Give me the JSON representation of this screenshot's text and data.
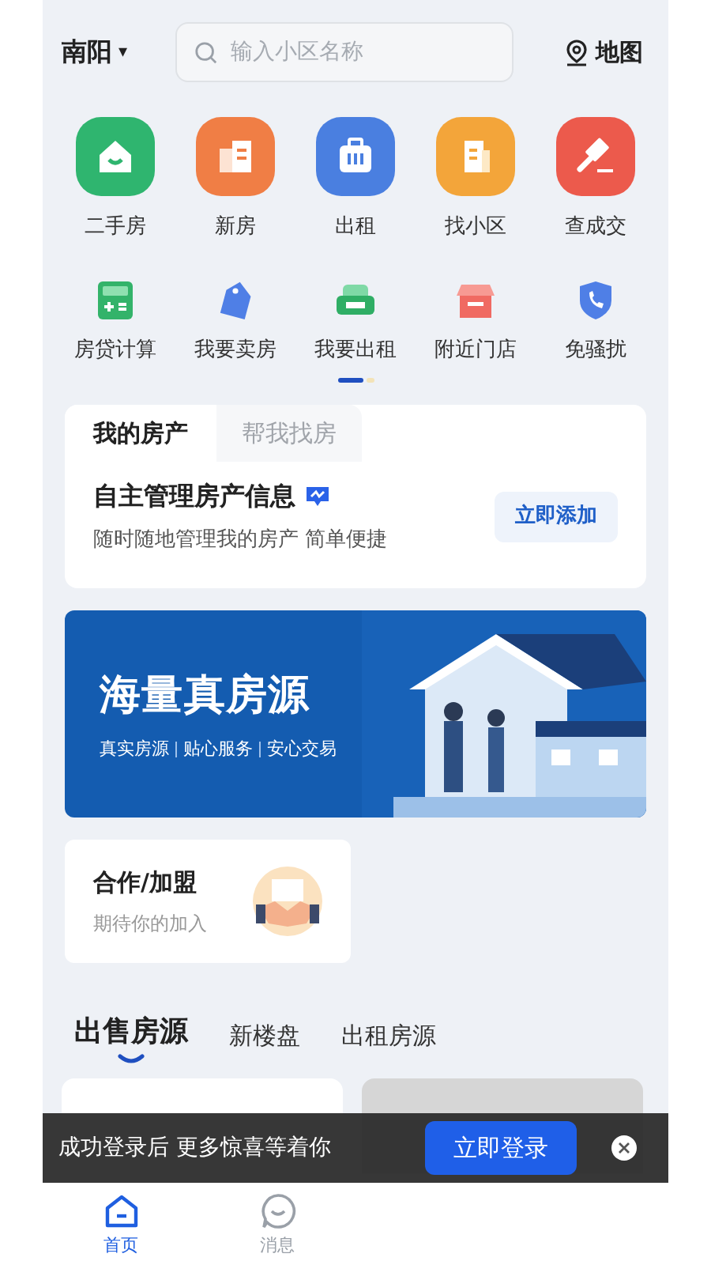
{
  "top_bar": {
    "city": "南阳",
    "caret": "▾",
    "search": {
      "placeholder": "输入小区名称"
    },
    "map": "地图"
  },
  "main_entries": [
    {
      "label": "二手房",
      "kind": "house",
      "color": "#2fb56f"
    },
    {
      "label": "新房",
      "kind": "building",
      "color": "#f07e45"
    },
    {
      "label": "出租",
      "kind": "suitcase",
      "color": "#4a7fe0"
    },
    {
      "label": "找小区",
      "kind": "tower",
      "color": "#f3a53a"
    },
    {
      "label": "查成交",
      "kind": "hammer",
      "color": "#ec5a4c"
    }
  ],
  "tools": [
    {
      "label": "房贷计算",
      "kind": "calculator"
    },
    {
      "label": "我要卖房",
      "kind": "tag"
    },
    {
      "label": "我要出租",
      "kind": "sofa"
    },
    {
      "label": "附近门店",
      "kind": "store"
    },
    {
      "label": "免骚扰",
      "kind": "shield"
    }
  ],
  "pager": [
    {
      "selected": true
    },
    {
      "selected": false
    }
  ],
  "property_card": {
    "tabs": [
      {
        "label": "我的房产",
        "selected": true
      },
      {
        "label": "帮我找房",
        "selected": false
      }
    ],
    "title": "自主管理房产信息",
    "subtitle": "随时随地管理我的房产 简单便捷",
    "button": "立即添加"
  },
  "banner": {
    "title": "海量真房源",
    "tagline": [
      "真实房源",
      "贴心服务",
      "安心交易"
    ]
  },
  "cooperation": {
    "title": "合作/加盟",
    "subtitle": "期待你的加入"
  },
  "listing_tabs": [
    {
      "label": "出售房源",
      "selected": true
    },
    {
      "label": "新楼盘",
      "selected": false
    },
    {
      "label": "出租房源",
      "selected": false
    }
  ],
  "login_bar": {
    "text": "成功登录后 更多惊喜等着你",
    "button": "立即登录"
  },
  "bottom_nav": [
    {
      "label": "首页",
      "kind": "home",
      "selected": true
    },
    {
      "label": "消息",
      "kind": "chat",
      "selected": false
    }
  ]
}
